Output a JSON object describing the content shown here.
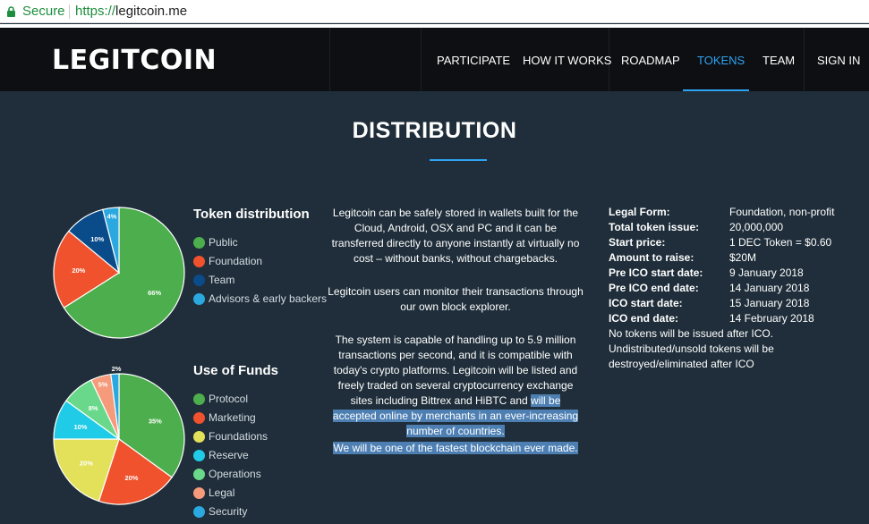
{
  "browser": {
    "secure_label": "Secure",
    "url_protocol": "https://",
    "url_host": "legitcoin.me"
  },
  "header": {
    "logo": "LEGITCOIN",
    "nav": [
      {
        "label": "PARTICIPATE",
        "active": false
      },
      {
        "label": "HOW IT WORKS",
        "active": false
      },
      {
        "label": "ROADMAP",
        "active": false
      },
      {
        "label": "TOKENS",
        "active": true
      },
      {
        "label": "TEAM",
        "active": false
      },
      {
        "label": "SIGN IN",
        "active": false
      }
    ]
  },
  "main": {
    "title": "DISTRIBUTION",
    "paragraphs": [
      "Legitcoin can be safely stored in wallets built for the Cloud, Android, OSX and PC and it can be transferred directly to anyone instantly at virtually no cost – without banks, without chargebacks.",
      "Legitcoin users can monitor their transactions through our own block explorer."
    ],
    "para3_a": "The system is capable of handling up to 5.9 million transactions per second, and it is compatible with today's crypto platforms. Legitcoin will be listed and freely traded on several cryptocurrency exchange sites including Bittrex and HiBTC and ",
    "para3_b": "will be accepted online by merchants in an ever-increasing number of countries.",
    "para4": "We will be one of the fastest blockchain ever made.",
    "info": [
      {
        "key": "Legal Form:",
        "value": "Foundation, non-profit"
      },
      {
        "key": "Total token issue:",
        "value": "20,000,000"
      },
      {
        "key": "Start price:",
        "value": "1 DEC Token = $0.60"
      },
      {
        "key": "Amount to raise:",
        "value": "$20M"
      },
      {
        "key": "Pre ICO start date:",
        "value": "9 January 2018"
      },
      {
        "key": "Pre ICO end date:",
        "value": "14 January 2018"
      },
      {
        "key": "ICO start date:",
        "value": "15 January 2018"
      },
      {
        "key": "ICO end date:",
        "value": "14 February 2018"
      }
    ],
    "note": "No tokens will be issued after ICO. Undistributed/unsold tokens will be destroyed/eliminated after ICO"
  },
  "chart_data": [
    {
      "type": "pie",
      "title": "Token distribution",
      "categories": [
        "Public",
        "Foundation",
        "Team",
        "Advisors & early backers"
      ],
      "values": [
        66,
        20,
        10,
        4
      ],
      "labels": [
        "66%",
        "20%",
        "10%",
        "4%"
      ],
      "colors": [
        "#4cae4c",
        "#f0522d",
        "#0a4b8a",
        "#2aa8df"
      ],
      "legend": "right"
    },
    {
      "type": "pie",
      "title": "Use of Funds",
      "categories": [
        "Protocol",
        "Marketing",
        "Foundations",
        "Reserve",
        "Operations",
        "Legal",
        "Security"
      ],
      "values": [
        35,
        20,
        20,
        10,
        8,
        5,
        2
      ],
      "labels": [
        "35%",
        "20%",
        "20%",
        "10%",
        "8%",
        "5%",
        "2%"
      ],
      "colors": [
        "#4cae4c",
        "#f0522d",
        "#e3e05a",
        "#1fcbe6",
        "#6ad88a",
        "#f59a7a",
        "#2aa8df"
      ],
      "legend": "right"
    }
  ]
}
